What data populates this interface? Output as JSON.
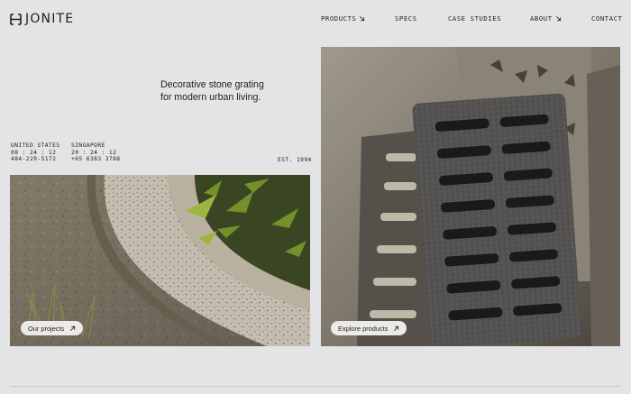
{
  "brand": {
    "name": "JONITE",
    "logo_icon": "jonite-bracket-mark"
  },
  "nav": {
    "items": [
      {
        "label": "PRODUCTS",
        "icon": "arrow-down-right-icon",
        "has_arrow": true
      },
      {
        "label": "SPECS",
        "has_arrow": false
      },
      {
        "label": "CASE STUDIES",
        "has_arrow": false
      },
      {
        "label": "ABOUT",
        "icon": "arrow-down-right-icon",
        "has_arrow": true
      },
      {
        "label": "CONTACT",
        "has_arrow": false
      }
    ]
  },
  "hero": {
    "tagline_line1": "Decorative stone grating",
    "tagline_line2": "for modern urban living."
  },
  "locations": [
    {
      "name": "UNITED STATES",
      "time": "08 : 24 : 12",
      "phone": "484-229-5172"
    },
    {
      "name": "SINGAPORE",
      "time": "20 : 24 : 12",
      "phone": "+65 6383 3788"
    }
  ],
  "est": "EST. 1994",
  "cards": {
    "projects": {
      "label": "Our projects",
      "icon": "arrow-up-right-icon"
    },
    "products": {
      "label": "Explore products",
      "icon": "arrow-up-right-icon"
    }
  },
  "colors": {
    "background": "#e3e4e6",
    "text": "#1e1e1e",
    "pill": "#eceae6"
  }
}
